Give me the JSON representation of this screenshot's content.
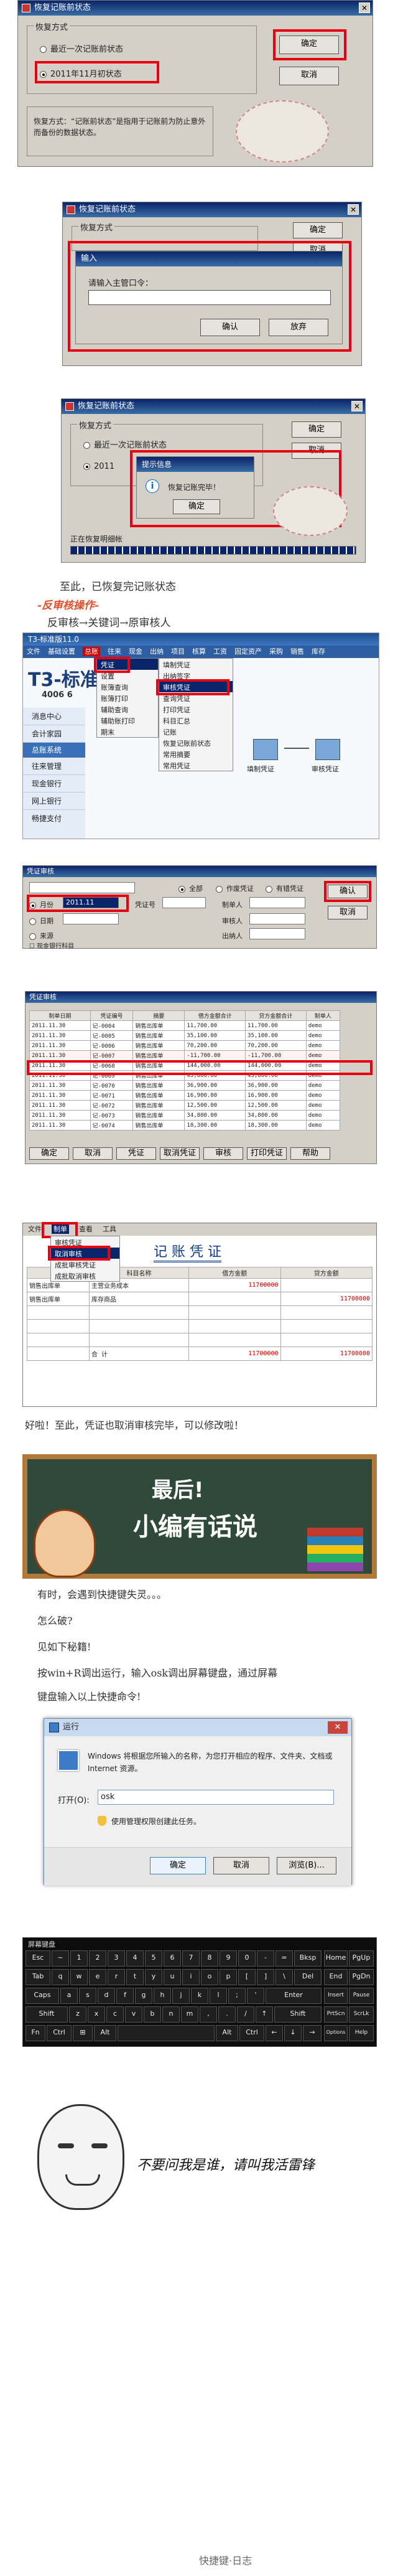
{
  "dlg1": {
    "title": "恢复记账前状态",
    "group": "恢复方式",
    "opt1": "最近一次记账前状态",
    "opt2": "2011年11月初状态",
    "ok": "确定",
    "cancel": "取消",
    "desc": "恢复方式：“记账前状态”是指用于记账前为防止意外而备份的数据状态。"
  },
  "dlg2": {
    "title": "恢复记账前状态",
    "group": "恢复方式",
    "inner_title": "输入",
    "prompt": "请输入主管口令：",
    "ok": "确定",
    "cancel": "取消",
    "inner_ok": "确认",
    "inner_cancel": "放弃"
  },
  "dlg3": {
    "title": "恢复记账前状态",
    "group": "恢复方式",
    "opt1": "最近一次记账前状态",
    "opt2": "2011",
    "ok": "确定",
    "cancel": "取消",
    "info_title": "提示信息",
    "info_text": "恢复记账完毕！",
    "info_ok": "确定",
    "status": "正在恢复明细帐"
  },
  "text1": "至此，已恢复完记账状态",
  "heading": "-反审核操作-",
  "text2": "反审核→关键词→原审核人",
  "app": {
    "title": "T3-标准版11.0",
    "menu": [
      "文件",
      "基础设置",
      "总账",
      "往来",
      "现金",
      "出纳",
      "项目",
      "核算",
      "工资",
      "固定资产",
      "采购",
      "销售",
      "库存"
    ],
    "logo": "T3-标准",
    "phone": "4006 6",
    "side": [
      "消息中心",
      "会计家园",
      "总账系统",
      "往来管理",
      "现金银行",
      "网上银行",
      "畅捷支付"
    ],
    "submenu1": [
      "凭证",
      "设置",
      "账簿查询",
      "账簿打印",
      "辅助查询",
      "辅助账打印",
      "期末"
    ],
    "submenu2": [
      "填制凭证",
      "出纳签字",
      "审核凭证",
      "查询凭证",
      "打印凭证",
      "科目汇总",
      "记账",
      "恢复记账前状态",
      "常用摘要",
      "常用凭证"
    ],
    "flow_fill": "填制凭证",
    "flow_audit": "审核凭证"
  },
  "audit_dlg": {
    "title": "凭证审核",
    "radio_all": "全部",
    "radio_void": "作废凭证",
    "radio_valid": "有错凭证",
    "month_label": "月份",
    "month_val": "2011.11",
    "date_label": "日期",
    "voucher_label": "凭证号",
    "maker_label": "制单人",
    "reviewer_label": "审核人",
    "cashier_label": "出纳人",
    "source": "来源",
    "confirm": "确认",
    "cancel": "取消",
    "check": "现金银行科目"
  },
  "voucher_list": {
    "title": "凭证审核",
    "headers": [
      "制单日期",
      "凭证编号",
      "摘要",
      "借方金额合计",
      "贷方金额合计",
      "制单人"
    ],
    "rows": [
      [
        "2011.11.30",
        "记-0004",
        "销售出库单",
        "11,700.00",
        "11,700.00",
        "demo"
      ],
      [
        "2011.11.30",
        "记-0005",
        "销售出库单",
        "35,100.00",
        "35,100.00",
        "demo"
      ],
      [
        "2011.11.30",
        "记-0006",
        "销售出库单",
        "70,200.00",
        "70,200.00",
        "demo"
      ],
      [
        "2011.11.30",
        "记-0007",
        "销售出库单",
        "-11,700.00",
        "-11,700.00",
        "demo"
      ],
      [
        "2011.11.30",
        "记-0068",
        "销售出库单",
        "144,000.00",
        "144,000.00",
        "demo"
      ],
      [
        "2011.11.30",
        "记-0069",
        "销售出库单",
        "45,600.00",
        "45,600.00",
        "demo"
      ],
      [
        "2011.11.30",
        "记-0070",
        "销售出库单",
        "36,900.00",
        "36,900.00",
        "demo"
      ],
      [
        "2011.11.30",
        "记-0071",
        "销售出库单",
        "16,900.00",
        "16,900.00",
        "demo"
      ],
      [
        "2011.11.30",
        "记-0072",
        "销售出库单",
        "12,500.00",
        "12,500.00",
        "demo"
      ],
      [
        "2011.11.30",
        "记-0073",
        "销售出库单",
        "34,800.00",
        "34,800.00",
        "demo"
      ],
      [
        "2011.11.30",
        "记-0074",
        "销售出库单",
        "18,300.00",
        "18,300.00",
        "demo"
      ]
    ],
    "buttons": [
      "确定",
      "取消",
      "凭证",
      "取消凭证",
      "审核",
      "打印凭证",
      "帮助"
    ]
  },
  "voucher": {
    "title": "记 账 凭 证",
    "menu": [
      "文件",
      "制单",
      "查看",
      "工具"
    ],
    "menu_items": [
      "审核凭证",
      "取消审核",
      "成批审核凭证",
      "成批取消审核"
    ],
    "headers": [
      "摘 要",
      "科目名称",
      "借方金额",
      "贷方金额"
    ],
    "rows": [
      [
        "销售出库单",
        "主营业务成本"
      ],
      [
        "销售出库单",
        "库存商品"
      ]
    ],
    "sum_label": "合 计",
    "amount": "11700000"
  },
  "text3": "好啦！至此，凭证也取消审核完毕，可以修改啦！",
  "banner": {
    "title1": "最后!",
    "title2": "小编有话说"
  },
  "text4": "有时，会遇到快捷键失灵。。。",
  "text5": "怎么破?",
  "text6": "见如下秘籍!",
  "text7": "按win+R调出运行，输入osk调出屏幕键盘，通过屏幕",
  "text8": "键盘输入以上快捷命令!",
  "run": {
    "title": "运行",
    "desc": "Windows 将根据您所输入的名称，为您打开相应的程序、文件夹、文档或 Internet 资源。",
    "open_label": "打开(O):",
    "value": "osk",
    "admin": "使用管理权限创建此任务。",
    "ok": "确定",
    "cancel": "取消",
    "browse": "浏览(B)..."
  },
  "osk": {
    "title": "屏幕键盘",
    "row1": [
      "Esc",
      "~",
      "1",
      "2",
      "3",
      "4",
      "5",
      "6",
      "7",
      "8",
      "9",
      "0",
      "-",
      "=",
      "Bksp",
      "Home",
      "PgUp"
    ],
    "row2": [
      "Tab",
      "q",
      "w",
      "e",
      "r",
      "t",
      "y",
      "u",
      "i",
      "o",
      "p",
      "[",
      "]",
      "\\",
      "Del",
      "End",
      "PgDn"
    ],
    "row3": [
      "Caps",
      "a",
      "s",
      "d",
      "f",
      "g",
      "h",
      "j",
      "k",
      "l",
      ";",
      "'",
      "Enter",
      "Insert",
      "Pause"
    ],
    "row4": [
      "Shift",
      "z",
      "x",
      "c",
      "v",
      "b",
      "n",
      "m",
      ",",
      ".",
      "/",
      "↑",
      "Shift",
      "PrtScn",
      "ScrLk"
    ],
    "row5": [
      "Fn",
      "Ctrl",
      "⊞",
      "Alt",
      "",
      "Alt",
      "Ctrl",
      "←",
      "↓",
      "→",
      "Options",
      "Help"
    ]
  },
  "meme_text": "不要问我是谁，请叫我活雷锋",
  "footer": "快捷键·日志"
}
